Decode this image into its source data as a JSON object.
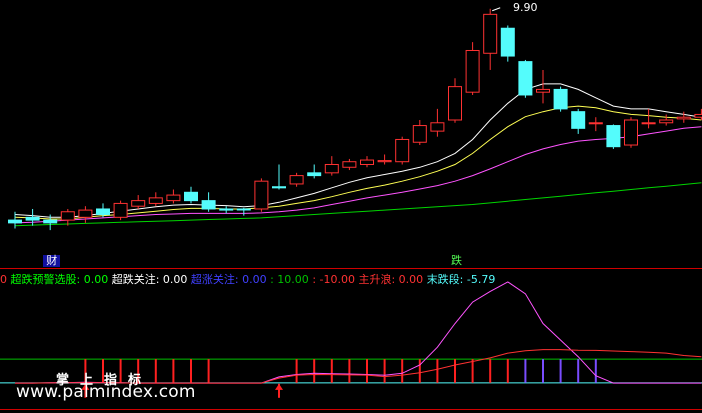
{
  "colors": {
    "background": "#000000",
    "bull": "#ff3232",
    "bear": "#54fcfc",
    "ma_white": "#ffffff",
    "ma_yellow": "#ffff54",
    "ma_magenta": "#ff54ff",
    "ma_green": "#00d400",
    "divider": "#d00000"
  },
  "price_panel": {
    "high_label": "9.90",
    "markers": [
      {
        "text": "财",
        "color": "#ffffff",
        "bg": "#1010a0",
        "at_bar": 2
      },
      {
        "text": "跌",
        "color": "#54fc54",
        "bg": "#102010",
        "at_bar": 25
      }
    ]
  },
  "legend": [
    {
      "text": "0",
      "color": "#ff3232"
    },
    {
      "text": " 超跌预警选股: 0.00",
      "color": "#00ff00"
    },
    {
      "text": "  超跌关注: 0.00",
      "color": "#ffffff"
    },
    {
      "text": "  超涨关注: 0.00",
      "color": "#4040ff"
    },
    {
      "text": "   : 10.00",
      "color": "#00c000"
    },
    {
      "text": "  : -10.00",
      "color": "#ff3232"
    },
    {
      "text": "  主升浪: 0.00",
      "color": "#ff3232"
    },
    {
      "text": "  末跌段: -5.79",
      "color": "#54fcfc"
    }
  ],
  "watermark": "www.palmindex.com",
  "brand": "掌上指标",
  "chart_data": [
    {
      "type": "candlestick",
      "title": "",
      "y_max_label": 9.9,
      "ohlc": [
        {
          "o": 6.1,
          "h": 6.25,
          "l": 5.95,
          "c": 6.05
        },
        {
          "o": 6.15,
          "h": 6.3,
          "l": 6.0,
          "c": 6.1
        },
        {
          "o": 6.1,
          "h": 6.2,
          "l": 5.92,
          "c": 6.05
        },
        {
          "o": 6.1,
          "h": 6.3,
          "l": 6.0,
          "c": 6.25
        },
        {
          "o": 6.15,
          "h": 6.35,
          "l": 6.05,
          "c": 6.28
        },
        {
          "o": 6.3,
          "h": 6.4,
          "l": 6.15,
          "c": 6.2
        },
        {
          "o": 6.15,
          "h": 6.45,
          "l": 6.1,
          "c": 6.4
        },
        {
          "o": 6.35,
          "h": 6.55,
          "l": 6.3,
          "c": 6.45
        },
        {
          "o": 6.4,
          "h": 6.6,
          "l": 6.35,
          "c": 6.5
        },
        {
          "o": 6.45,
          "h": 6.65,
          "l": 6.4,
          "c": 6.55
        },
        {
          "o": 6.6,
          "h": 6.7,
          "l": 6.4,
          "c": 6.45
        },
        {
          "o": 6.45,
          "h": 6.6,
          "l": 6.25,
          "c": 6.3
        },
        {
          "o": 6.3,
          "h": 6.35,
          "l": 6.22,
          "c": 6.28
        },
        {
          "o": 6.3,
          "h": 6.32,
          "l": 6.18,
          "c": 6.29
        },
        {
          "o": 6.3,
          "h": 6.85,
          "l": 6.25,
          "c": 6.8
        },
        {
          "o": 6.7,
          "h": 7.1,
          "l": 6.65,
          "c": 6.68
        },
        {
          "o": 6.75,
          "h": 6.95,
          "l": 6.7,
          "c": 6.9
        },
        {
          "o": 6.95,
          "h": 7.1,
          "l": 6.85,
          "c": 6.9
        },
        {
          "o": 6.95,
          "h": 7.25,
          "l": 6.9,
          "c": 7.1
        },
        {
          "o": 7.05,
          "h": 7.2,
          "l": 7.0,
          "c": 7.15
        },
        {
          "o": 7.1,
          "h": 7.25,
          "l": 7.05,
          "c": 7.18
        },
        {
          "o": 7.15,
          "h": 7.28,
          "l": 7.1,
          "c": 7.17
        },
        {
          "o": 7.15,
          "h": 7.6,
          "l": 7.1,
          "c": 7.55
        },
        {
          "o": 7.5,
          "h": 7.9,
          "l": 7.45,
          "c": 7.8
        },
        {
          "o": 7.7,
          "h": 8.1,
          "l": 7.6,
          "c": 7.85
        },
        {
          "o": 7.9,
          "h": 8.65,
          "l": 7.85,
          "c": 8.5
        },
        {
          "o": 8.4,
          "h": 9.3,
          "l": 8.35,
          "c": 9.15
        },
        {
          "o": 9.1,
          "h": 9.9,
          "l": 8.8,
          "c": 9.8
        },
        {
          "o": 9.55,
          "h": 9.6,
          "l": 8.95,
          "c": 9.05
        },
        {
          "o": 8.95,
          "h": 8.98,
          "l": 8.3,
          "c": 8.35
        },
        {
          "o": 8.4,
          "h": 8.8,
          "l": 8.2,
          "c": 8.45
        },
        {
          "o": 8.45,
          "h": 8.5,
          "l": 8.05,
          "c": 8.1
        },
        {
          "o": 8.05,
          "h": 8.1,
          "l": 7.65,
          "c": 7.75
        },
        {
          "o": 7.85,
          "h": 7.95,
          "l": 7.7,
          "c": 7.85
        },
        {
          "o": 7.8,
          "h": 7.82,
          "l": 7.38,
          "c": 7.42
        },
        {
          "o": 7.45,
          "h": 7.95,
          "l": 7.4,
          "c": 7.9
        },
        {
          "o": 7.85,
          "h": 8.1,
          "l": 7.75,
          "c": 7.85
        },
        {
          "o": 7.85,
          "h": 8.0,
          "l": 7.8,
          "c": 7.9
        },
        {
          "o": 7.92,
          "h": 8.05,
          "l": 7.85,
          "c": 7.95
        },
        {
          "o": 7.95,
          "h": 8.1,
          "l": 7.9,
          "c": 8.0
        }
      ],
      "moving_averages": [
        {
          "color": "#ffffff",
          "values": [
            6.2,
            6.18,
            6.15,
            6.15,
            6.18,
            6.22,
            6.26,
            6.3,
            6.34,
            6.37,
            6.38,
            6.37,
            6.36,
            6.34,
            6.36,
            6.42,
            6.5,
            6.58,
            6.68,
            6.78,
            6.86,
            6.92,
            6.98,
            7.05,
            7.15,
            7.3,
            7.55,
            7.9,
            8.2,
            8.45,
            8.55,
            8.55,
            8.45,
            8.3,
            8.15,
            8.1,
            8.1,
            8.05,
            8.0,
            7.95
          ]
        },
        {
          "color": "#ffff54",
          "values": [
            6.15,
            6.14,
            6.12,
            6.12,
            6.15,
            6.18,
            6.2,
            6.23,
            6.26,
            6.29,
            6.31,
            6.31,
            6.3,
            6.3,
            6.32,
            6.35,
            6.4,
            6.45,
            6.52,
            6.6,
            6.67,
            6.73,
            6.8,
            6.88,
            6.98,
            7.1,
            7.3,
            7.55,
            7.78,
            7.96,
            8.05,
            8.12,
            8.15,
            8.12,
            8.05,
            8.0,
            7.98,
            7.95,
            7.93,
            7.9
          ]
        },
        {
          "color": "#ff54ff",
          "values": [
            6.05,
            6.06,
            6.08,
            6.1,
            6.12,
            6.14,
            6.16,
            6.18,
            6.2,
            6.21,
            6.22,
            6.22,
            6.22,
            6.22,
            6.23,
            6.25,
            6.28,
            6.32,
            6.38,
            6.44,
            6.5,
            6.55,
            6.6,
            6.66,
            6.72,
            6.8,
            6.9,
            7.02,
            7.15,
            7.28,
            7.38,
            7.46,
            7.52,
            7.55,
            7.57,
            7.6,
            7.65,
            7.7,
            7.75,
            7.78
          ]
        },
        {
          "color": "#00d400",
          "values": [
            6.0,
            6.01,
            6.02,
            6.03,
            6.04,
            6.05,
            6.06,
            6.07,
            6.08,
            6.09,
            6.1,
            6.11,
            6.12,
            6.13,
            6.14,
            6.16,
            6.18,
            6.2,
            6.22,
            6.24,
            6.26,
            6.28,
            6.3,
            6.32,
            6.34,
            6.36,
            6.38,
            6.41,
            6.44,
            6.47,
            6.5,
            6.53,
            6.56,
            6.59,
            6.62,
            6.65,
            6.68,
            6.71,
            6.74,
            6.77
          ]
        }
      ]
    },
    {
      "type": "line",
      "title": "",
      "levels": [
        10.0,
        -10.0
      ],
      "series": [
        {
          "color": "#ff54ff",
          "values": [
            -10.2,
            -10.2,
            -10.0,
            -9.8,
            -9.6,
            -9.8,
            -10.0,
            -10.2,
            -10.2,
            -10.2,
            -10.2,
            -10.2,
            -10.2,
            -10.2,
            -10.2,
            -5,
            -3,
            -2,
            -2.3,
            -2.6,
            -3,
            -3.6,
            -2,
            5,
            20,
            40,
            58,
            67,
            75,
            65,
            40,
            26,
            12,
            -4,
            -10.2,
            -10.2,
            -10.2,
            -10.2,
            -10.2,
            -10.2
          ]
        },
        {
          "color": "#ff3232",
          "values": [
            -10.2,
            -10.2,
            -10.1,
            -10.0,
            -9.9,
            -10.0,
            -10.1,
            -10.2,
            -10.2,
            -10.2,
            -10.2,
            -10.2,
            -10.2,
            -10.2,
            -10.2,
            -6,
            -3.5,
            -3,
            -3.1,
            -3.3,
            -3.5,
            -4.8,
            -3.5,
            -1.5,
            1.5,
            5,
            8,
            11,
            15,
            17,
            18,
            18,
            17.5,
            17.3,
            16.8,
            16.3,
            15.8,
            15,
            13,
            12
          ]
        }
      ],
      "red_bars_at": [
        4,
        5,
        6,
        7,
        8,
        9,
        10,
        11,
        16,
        17,
        18,
        19,
        20,
        21,
        22,
        23,
        24,
        25,
        26,
        27,
        28
      ],
      "blue_bars_at": [
        29,
        30,
        31,
        32,
        33
      ],
      "arrows_at": [
        4,
        15
      ]
    }
  ]
}
